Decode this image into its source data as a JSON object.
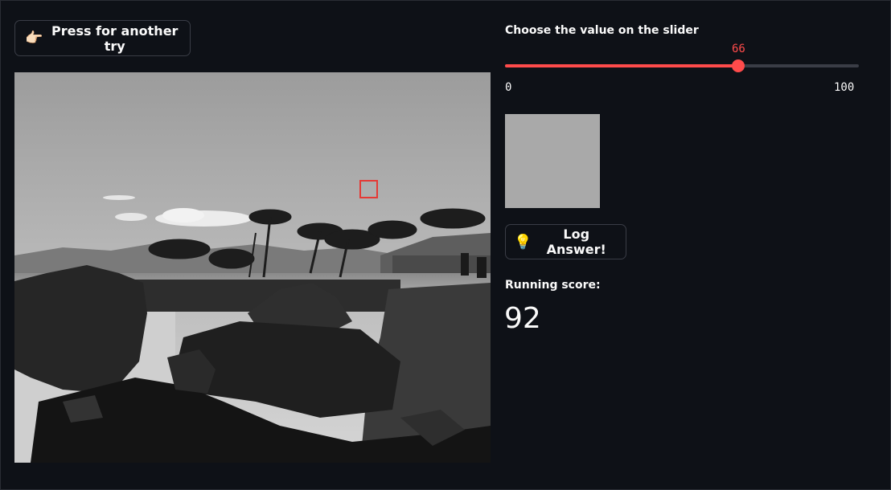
{
  "controls": {
    "retry_icon": "pointing-hand-icon",
    "retry_emoji": "👉🏻",
    "retry_label": "Press for another try",
    "log_icon": "lightbulb-icon",
    "log_emoji": "💡",
    "log_label": "Log Answer!"
  },
  "slider": {
    "label": "Choose the value on the slider",
    "value": 66,
    "value_text": "66",
    "min": 0,
    "min_text": "0",
    "max": 100,
    "max_text": "100",
    "accent_color": "#ff4b4b"
  },
  "swatch": {
    "color": "#a9a9a9"
  },
  "score": {
    "label": "Running score:",
    "value": "92"
  },
  "colors": {
    "background": "#0e1117",
    "target_box": "#e53935"
  }
}
